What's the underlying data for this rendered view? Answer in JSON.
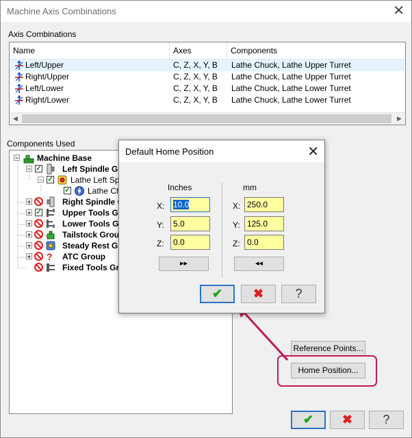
{
  "window": {
    "title": "Machine Axis Combinations",
    "close_glyph": "✕"
  },
  "axis_combinations": {
    "label": "Axis Combinations",
    "columns": [
      "Name",
      "Axes",
      "Components"
    ],
    "rows": [
      {
        "name": "Left/Upper",
        "axes": "C, Z, X, Y, B",
        "components": "Lathe Chuck, Lathe Upper Turret"
      },
      {
        "name": "Right/Upper",
        "axes": "C, Z, X, Y, B",
        "components": "Lathe Chuck, Lathe Upper Turret"
      },
      {
        "name": "Left/Lower",
        "axes": "C, Z, X, Y, B",
        "components": "Lathe Chuck, Lathe Lower Turret"
      },
      {
        "name": "Right/Lower",
        "axes": "C, Z, X, Y, B",
        "components": "Lathe Chuck, Lathe Lower Turret"
      }
    ]
  },
  "components_used": {
    "label": "Components Used",
    "tree": [
      {
        "label": "Machine Base"
      },
      {
        "label": "Left Spindle Gr"
      },
      {
        "label": "Lathe Left Sp"
      },
      {
        "label": "Lathe Chu"
      },
      {
        "label": "Right Spindle G"
      },
      {
        "label": "Upper Tools Gr"
      },
      {
        "label": "Lower Tools Gr"
      },
      {
        "label": "Tailstock Group"
      },
      {
        "label": "Steady Rest Gr"
      },
      {
        "label": "ATC Group"
      },
      {
        "label": "Fixed Tools Gro"
      }
    ]
  },
  "buttons": {
    "reference_points": "Reference Points...",
    "home_position": "Home Position...",
    "ok_glyph": "✔",
    "cancel_glyph": "✖",
    "help_glyph": "?"
  },
  "home_dialog": {
    "title": "Default Home Position",
    "close_glyph": "✕",
    "inches_label": "Inches",
    "mm_label": "mm",
    "inches": {
      "x": "10.0",
      "y": "5.0",
      "z": "0.0"
    },
    "mm": {
      "x": "250.0",
      "y": "125.0",
      "z": "0.0"
    },
    "x_label": "X:",
    "y_label": "Y:",
    "z_label": "Z:",
    "to_mm_glyph": "▸▸",
    "to_inch_glyph": "◂◂",
    "ok_glyph": "✔",
    "cancel_glyph": "✖",
    "help_glyph": "?"
  },
  "colors": {
    "accent": "#2a72c9",
    "highlight": "#c2185b",
    "check_green": "#1aa51a",
    "cancel_red": "#e02020",
    "field_yellow": "#ffffa0"
  }
}
